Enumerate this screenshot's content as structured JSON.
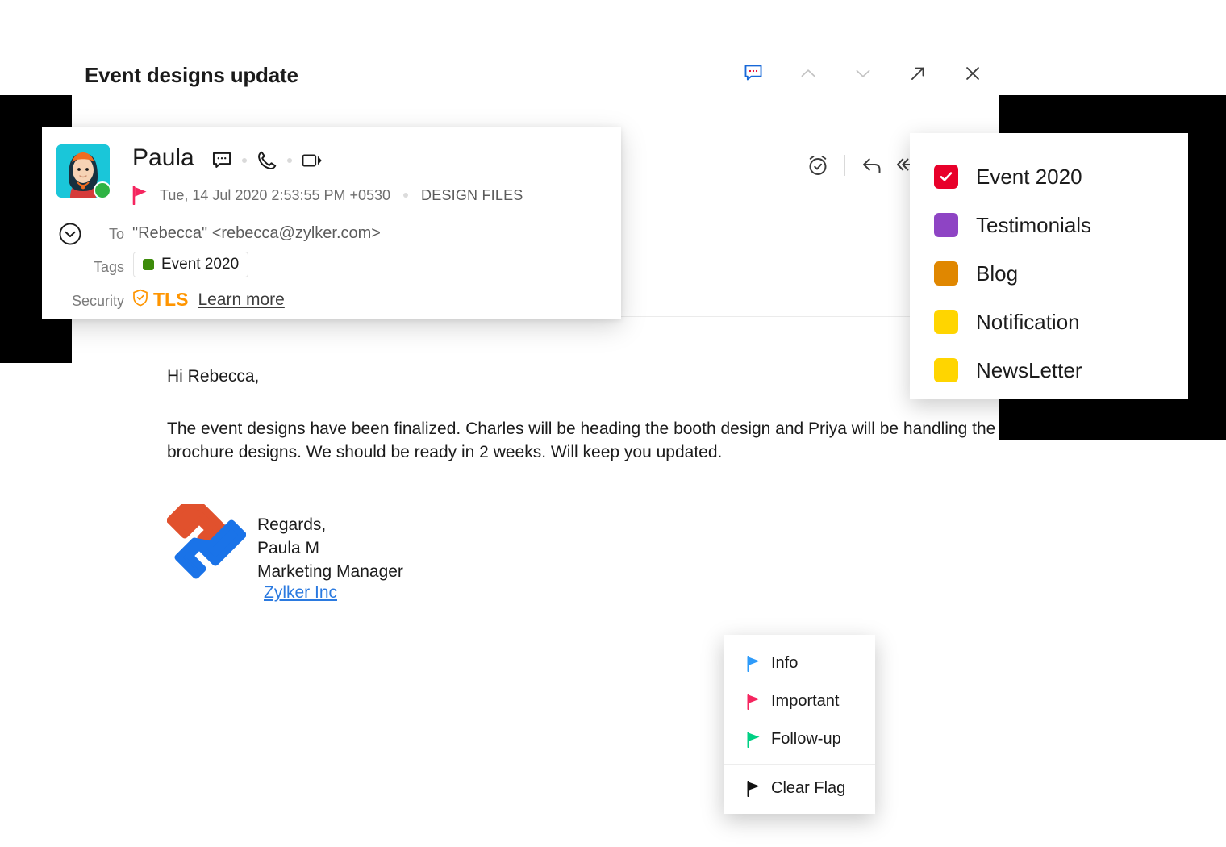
{
  "window": {
    "subject": "Event designs update",
    "header_actions": [
      {
        "name": "comment-icon",
        "label": "Comment"
      },
      {
        "name": "chevron-up-icon",
        "label": "Previous"
      },
      {
        "name": "chevron-down-icon",
        "label": "Next"
      },
      {
        "name": "open-external-icon",
        "label": "Open in new window"
      },
      {
        "name": "close-icon",
        "label": "Close"
      }
    ]
  },
  "sender": {
    "name": "Paula",
    "date": "Tue, 14 Jul 2020 2:53:55 PM +0530",
    "folder": "DESIGN FILES",
    "flag_color": "#f5255f",
    "presence_color": "#2fb344",
    "to_label": "To",
    "to_value": "\"Rebecca\" <rebecca@zylker.com>",
    "tags_label": "Tags",
    "tag_chip": {
      "label": "Event 2020",
      "color": "#3d8b0a"
    },
    "security_label": "Security",
    "security_value": "TLS",
    "security_color": "#ff9500",
    "learn_more": "Learn more",
    "quick_actions": [
      {
        "name": "chat-icon",
        "label": "Chat"
      },
      {
        "name": "phone-icon",
        "label": "Call"
      },
      {
        "name": "video-icon",
        "label": "Video call"
      }
    ],
    "reply_actions": [
      {
        "name": "snooze-icon",
        "label": "Snooze"
      },
      {
        "name": "reply-icon",
        "label": "Reply"
      },
      {
        "name": "reply-all-icon",
        "label": "Reply all"
      }
    ]
  },
  "body": {
    "greeting": "Hi Rebecca,",
    "paragraph": "The event designs have been finalized. Charles will be heading the booth design and Priya will be handling the brochure designs. We should be ready in 2 weeks. Will keep you updated.",
    "signature": {
      "regards": "Regards,",
      "name": "Paula M",
      "title": "Marketing Manager",
      "company": "Zylker Inc",
      "company_link_color": "#2b7ae0",
      "logo_colors": {
        "top": "#e1512d",
        "bottom": "#1a73e8"
      }
    }
  },
  "tag_menu": {
    "items": [
      {
        "label": "Event 2020",
        "color": "#e8002a",
        "checked": true
      },
      {
        "label": "Testimonials",
        "color": "#8e44c4",
        "checked": false
      },
      {
        "label": "Blog",
        "color": "#e08700",
        "checked": false
      },
      {
        "label": "Notification",
        "color": "#ffd500",
        "checked": false
      },
      {
        "label": "NewsLetter",
        "color": "#ffd500",
        "checked": false
      }
    ]
  },
  "flag_menu": {
    "items": [
      {
        "label": "Info",
        "color": "#2e9bfa"
      },
      {
        "label": "Important",
        "color": "#f5255f"
      },
      {
        "label": "Follow-up",
        "color": "#00d084"
      },
      {
        "label": "Clear Flag",
        "color": "#111111"
      }
    ]
  }
}
